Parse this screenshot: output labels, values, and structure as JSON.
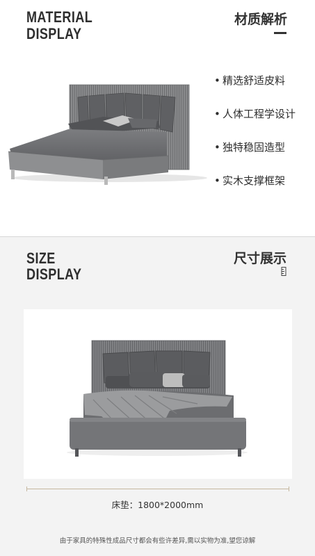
{
  "material": {
    "title_en_line1": "MATERIAL",
    "title_en_line2": "DISPLAY",
    "title_cn": "材质解析",
    "bullet": "•",
    "features": [
      "精选舒适皮料",
      "人体工程学设计",
      "独特稳固造型",
      "实木支撑框架"
    ]
  },
  "size": {
    "title_en_line1": "SIZE",
    "title_en_line2": "DISPLAY",
    "title_cn": "尺寸展示",
    "title_icon": "ruler-icon",
    "mattress_label": "床垫：1800*2000mm"
  },
  "footer": {
    "disclaimer": "由于家具的特殊性成品尺寸都会有些许差异,需以实物为准,望您谅解"
  },
  "colors": {
    "accent_line": "#c5b79f",
    "upholstery": "#6f7072",
    "background": "#f3f3f3"
  }
}
